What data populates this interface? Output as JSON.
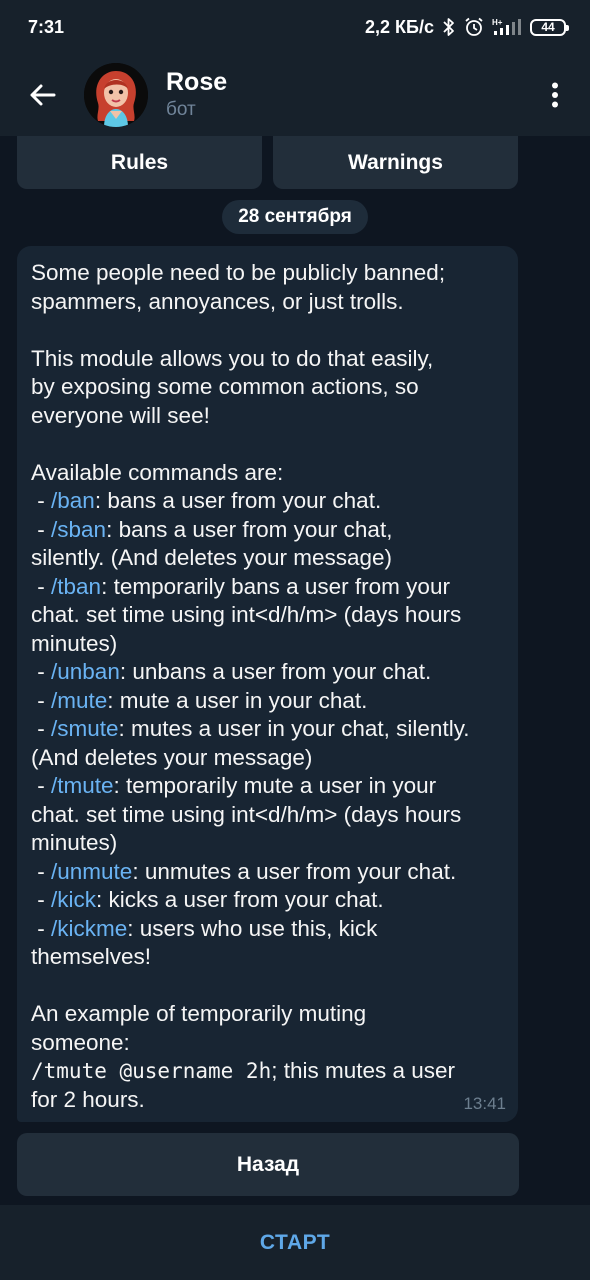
{
  "status_bar": {
    "time": "7:31",
    "speed": "2,2 КБ/с",
    "network": "H+",
    "battery": "44"
  },
  "header": {
    "title": "Rose",
    "subtitle": "бот",
    "back_icon": "arrow-left-icon",
    "menu_icon": "more-vertical-icon"
  },
  "inline_keyboard": [
    "Rules",
    "Warnings"
  ],
  "date_label": "28 сентября",
  "message": {
    "time": "13:41",
    "segments": [
      {
        "t": "Some people need to be publicly banned;\nspammers, annoyances, or just trolls.\n\nThis module allows you to do that easily,\nby exposing some common actions, so\neveryone will see!\n\nAvailable commands are:\n - "
      },
      {
        "t": "/ban",
        "c": "cmd"
      },
      {
        "t": ": bans a user from your chat.\n - "
      },
      {
        "t": "/sban",
        "c": "cmd"
      },
      {
        "t": ": bans a user from your chat,\nsilently. (And deletes your message)\n - "
      },
      {
        "t": "/tban",
        "c": "cmd"
      },
      {
        "t": ": temporarily bans a user from your\nchat. set time using int<d/h/m> (days hours\nminutes)\n - "
      },
      {
        "t": "/unban",
        "c": "cmd"
      },
      {
        "t": ": unbans a user from your chat.\n - "
      },
      {
        "t": "/mute",
        "c": "cmd"
      },
      {
        "t": ": mute a user in your chat.\n - "
      },
      {
        "t": "/smute",
        "c": "cmd"
      },
      {
        "t": ": mutes a user in your chat, silently.\n(And deletes your message)\n - "
      },
      {
        "t": "/tmute",
        "c": "cmd"
      },
      {
        "t": ": temporarily mute a user in your\nchat. set time using int<d/h/m> (days hours\nminutes)\n - "
      },
      {
        "t": "/unmute",
        "c": "cmd"
      },
      {
        "t": ": unmutes a user from your chat.\n - "
      },
      {
        "t": "/kick",
        "c": "cmd"
      },
      {
        "t": ": kicks a user from your chat.\n - "
      },
      {
        "t": "/kickme",
        "c": "cmd"
      },
      {
        "t": ": users who use this, kick\nthemselves!\n\nAn example of temporarily muting\nsomeone:\n"
      },
      {
        "t": "/tmute @username 2h",
        "c": "mono"
      },
      {
        "t": "; this mutes a user\nfor 2 hours."
      }
    ]
  },
  "reply_keyboard": {
    "back_label": "Назад"
  },
  "start_button": {
    "label": "СТАРТ"
  },
  "colors": {
    "background": "#0e1621",
    "bar": "#17212b",
    "bubble": "#182533",
    "link": "#6ab3f3",
    "accent": "#5fa8e8"
  }
}
